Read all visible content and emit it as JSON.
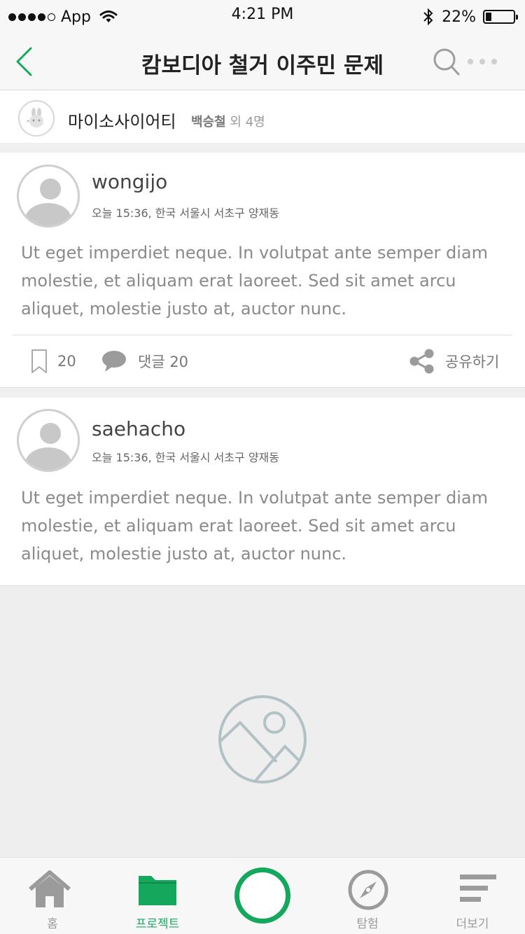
{
  "status_bar": {
    "carrier": "App",
    "time": "4:21 PM",
    "battery_percent": "22%",
    "battery_level": 0.22,
    "signal_bars_filled": 4,
    "signal_bars_total": 5
  },
  "nav": {
    "title": "캄보디아 철거 이주민 문제",
    "back_icon": "chevron-left-icon",
    "search_icon": "search-icon",
    "more_icon": "more-dots-icon"
  },
  "group": {
    "name": "마이소사이어티",
    "lead_member": "백승철",
    "others": " 외 4명"
  },
  "posts": [
    {
      "username": "wongijo",
      "meta": "오늘 15:36, 한국 서울시 서초구 양재동",
      "text": "Ut eget imperdiet neque. In volutpat ante semper diam molestie, et aliquam erat laoreet. Sed sit amet arcu aliquet, molestie justo at, auctor nunc.",
      "bookmark_count": "20",
      "comment_label": "댓글 20",
      "share_label": "공유하기"
    },
    {
      "username": "saehacho",
      "meta": "오늘 15:36, 한국 서울시 서초구 양재동",
      "text": "Ut eget imperdiet neque. In volutpat ante semper diam molestie, et aliquam erat laoreet. Sed sit amet arcu aliquet, molestie justo at, auctor nunc."
    }
  ],
  "tabs": [
    {
      "label": "홈",
      "icon": "home-icon"
    },
    {
      "label": "프로젝트",
      "icon": "folder-icon",
      "active": true
    },
    {
      "label": "",
      "icon": "create-ring-icon"
    },
    {
      "label": "탐험",
      "icon": "compass-icon"
    },
    {
      "label": "더보기",
      "icon": "menu-lines-icon"
    }
  ],
  "colors": {
    "accent": "#14a85c",
    "muted_text": "#8a8a8a",
    "placeholder_icon": "#b3c1c7"
  }
}
